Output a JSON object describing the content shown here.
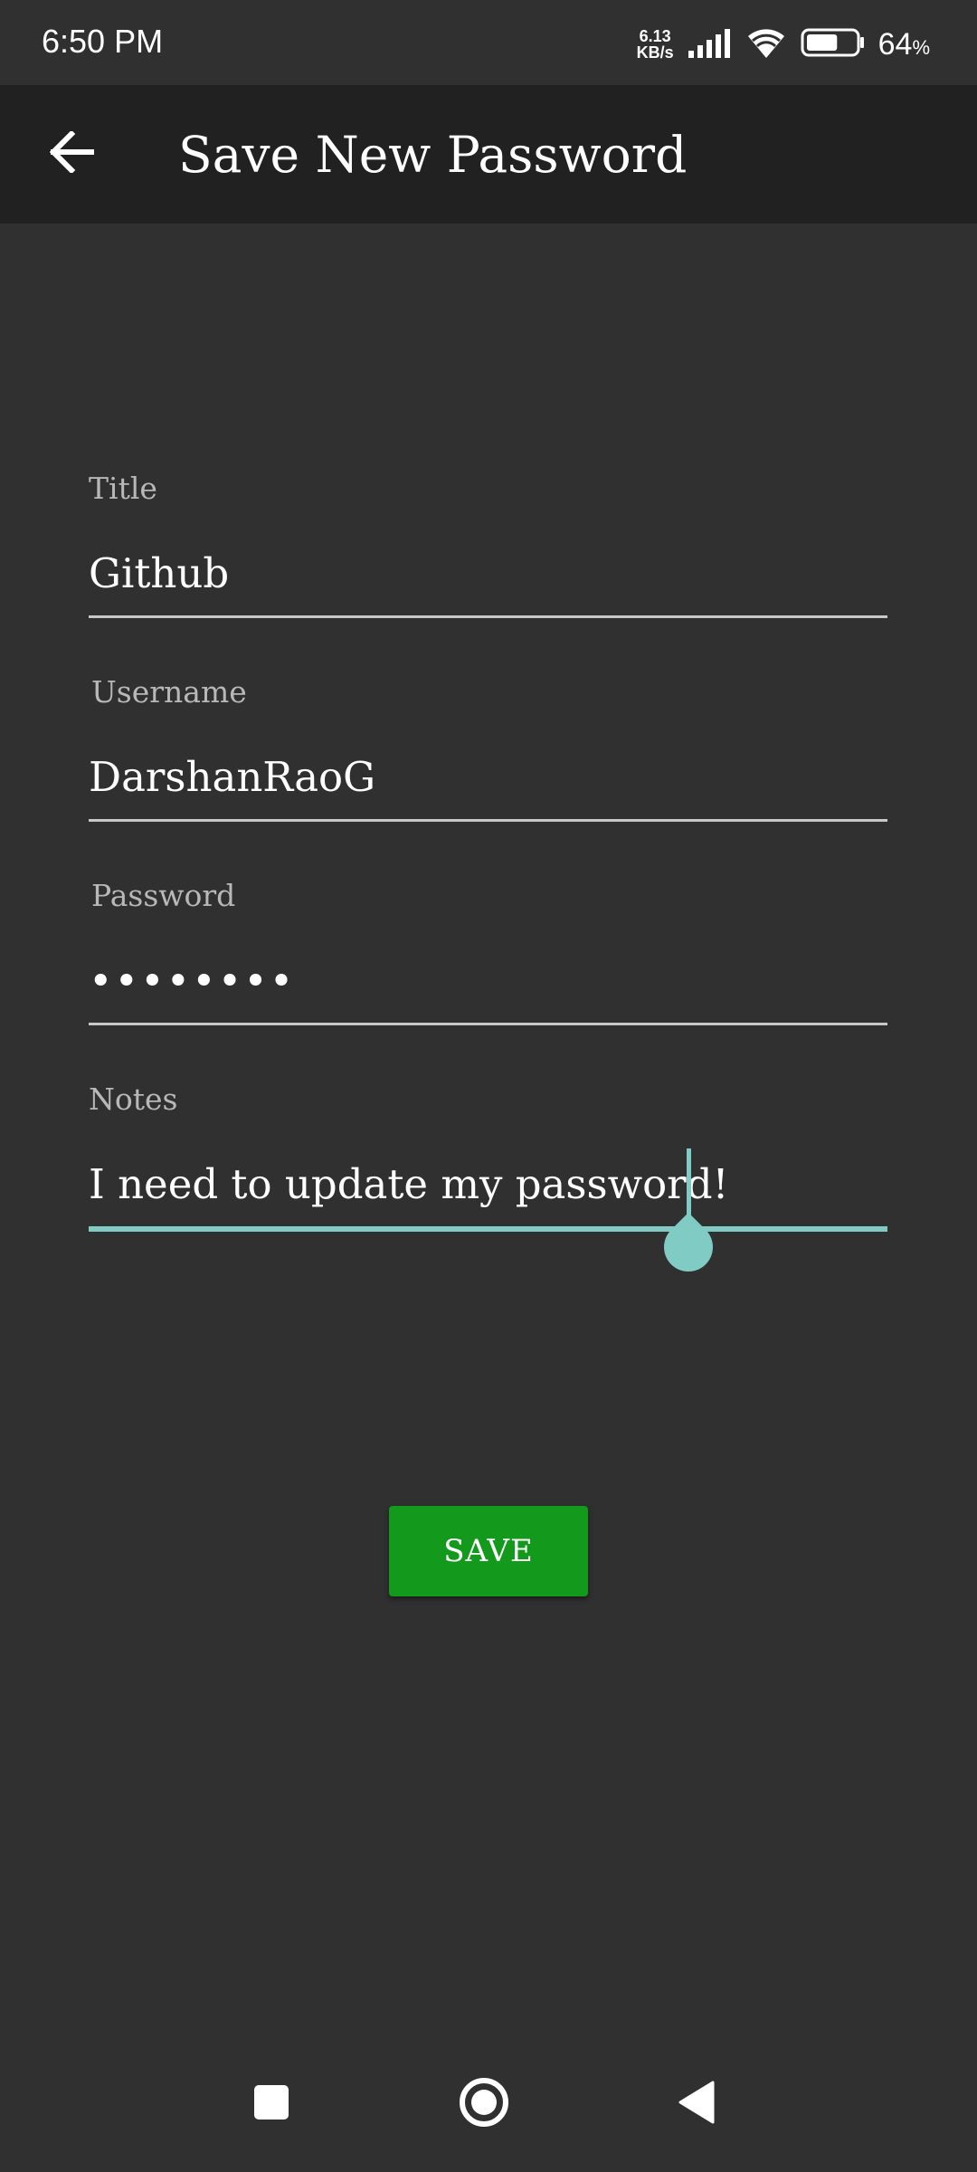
{
  "status_bar": {
    "time": "6:50 PM",
    "net_speed_value": "6.13",
    "net_speed_unit": "KB/s",
    "battery_number": "64",
    "battery_unit": "%",
    "battery_level": 0.64,
    "icons": [
      "signal-icon",
      "wifi-icon",
      "battery-icon"
    ]
  },
  "app_bar": {
    "back_icon": "arrow-back-icon",
    "title": "Save New Password"
  },
  "form": {
    "title_field": {
      "label": "Title",
      "value": "Github"
    },
    "username_field": {
      "label": "Username",
      "value": "DarshanRaoG"
    },
    "password_field": {
      "label": "Password",
      "value": "••••••••"
    },
    "notes_field": {
      "label": "Notes",
      "value": "I need to update my password!"
    }
  },
  "save_button": {
    "label": "SAVE"
  },
  "nav_bar": {
    "icons": [
      "recents-square-icon",
      "home-circle-icon",
      "back-triangle-icon"
    ]
  },
  "colors": {
    "background": "#303030",
    "app_bar": "#212121",
    "accent": "#80cbc4",
    "save_button": "#139a1c",
    "label": "#b8b8b8"
  }
}
